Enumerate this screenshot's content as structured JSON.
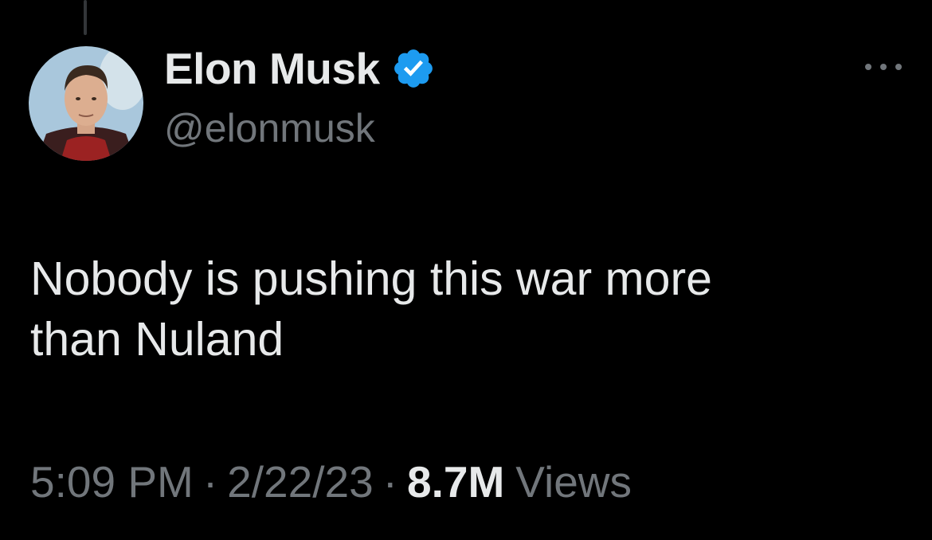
{
  "tweet": {
    "author": {
      "display_name": "Elon Musk",
      "handle": "@elonmusk",
      "verified": true,
      "verified_color": "#1d9bf0"
    },
    "text_lines": [
      "Nobody is pushing this war more",
      "than Nuland"
    ],
    "meta": {
      "time": "5:09 PM",
      "separator": "·",
      "date": "2/22/23",
      "views_count": "8.7M",
      "views_label": "Views"
    }
  },
  "icons": {
    "more": "more-horizontal-icon",
    "verified": "verified-badge-icon"
  },
  "colors": {
    "background": "#000000",
    "primary_text": "#e7e9ea",
    "secondary_text": "#71767b",
    "accent": "#1d9bf0"
  }
}
